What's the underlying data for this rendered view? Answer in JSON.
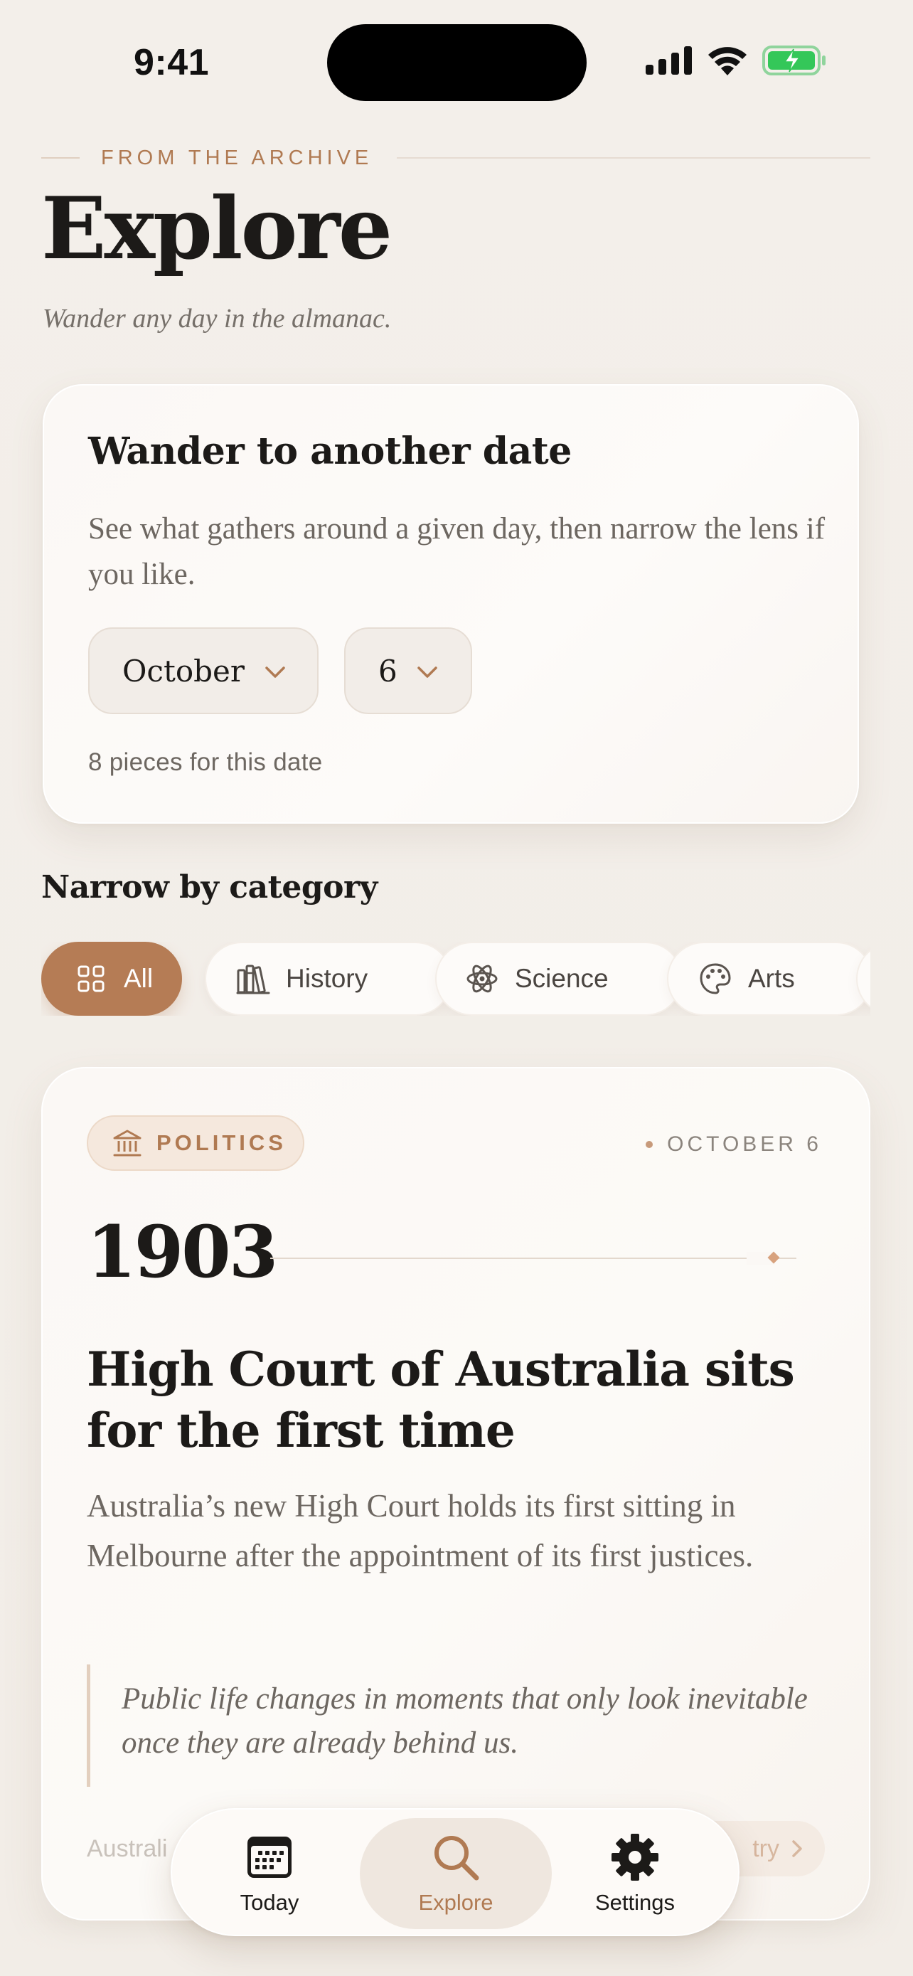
{
  "status_bar": {
    "time": "9:41",
    "icons": [
      "cellular-signal-icon",
      "wifi-icon",
      "battery-charging-icon"
    ]
  },
  "header": {
    "eyebrow": "FROM THE ARCHIVE",
    "title": "Explore",
    "subtitle": "Wander any day in the almanac."
  },
  "date_picker": {
    "title": "Wander to another date",
    "description": "See what gathers around a given day, then narrow the lens if you like.",
    "month": "October",
    "day": "6",
    "count_text": "8 pieces for this date"
  },
  "categories": {
    "title": "Narrow by category",
    "selected": "All",
    "items": [
      {
        "label": "All",
        "icon": "grid-icon"
      },
      {
        "label": "History",
        "icon": "books-icon"
      },
      {
        "label": "Science",
        "icon": "atom-icon"
      },
      {
        "label": "Arts",
        "icon": "palette-icon"
      }
    ]
  },
  "event": {
    "category": "POLITICS",
    "category_icon": "columns-building-icon",
    "date": "OCTOBER 6",
    "year": "1903",
    "title": "High Court of Australia sits for the first time",
    "description": "Australia’s new High Court holds its first sitting in Melbourne after the appointment of its first justices.",
    "quote": "Public life changes in moments that only look inevitable once they are already behind us.",
    "footer_text": "Australi",
    "footer_link": "try"
  },
  "tab_bar": {
    "active": "Explore",
    "tabs": [
      {
        "label": "Today",
        "icon": "calendar-icon"
      },
      {
        "label": "Explore",
        "icon": "search-icon"
      },
      {
        "label": "Settings",
        "icon": "gear-icon"
      }
    ]
  },
  "colors": {
    "accent": "#b57c55",
    "background": "#f3efea",
    "card": "#fbf8f5",
    "text_primary": "#1c1a18",
    "text_secondary": "#6d6761",
    "battery_green": "#34c759"
  }
}
